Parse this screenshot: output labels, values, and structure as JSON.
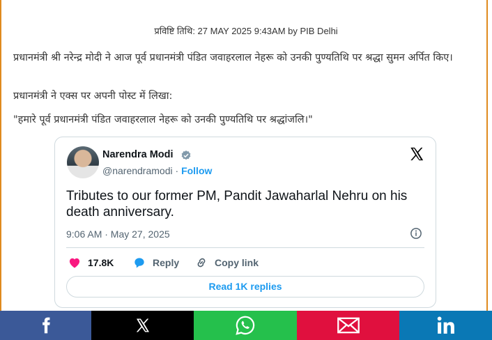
{
  "release": {
    "meta": "प्रविष्टि तिथि: 27 MAY 2025 9:43AM by PIB Delhi"
  },
  "body": {
    "para1": "प्रधानमंत्री श्री नरेन्द्र मोदी ने आज पूर्व प्रधानमंत्री पंडित जवाहरलाल नेहरू को उनकी पुण्यतिथि पर श्रद्धा सुमन अर्पित किए।",
    "para2": "प्रधानमंत्री ने एक्स पर अपनी पोस्ट में लिखा:",
    "para3": "\"हमारे पूर्व प्रधानमंत्री पंडित जवाहरलाल नेहरू को उनकी पुण्यतिथि पर श्रद्धांजलि।\""
  },
  "tweet": {
    "author_name": "Narendra Modi",
    "handle": "@narendramodi",
    "separator": "·",
    "follow_label": "Follow",
    "text": "Tributes to our former PM, Pandit Jawaharlal Nehru on his death anniversary.",
    "timestamp": "9:06 AM · May 27, 2025",
    "likes": "17.8K",
    "reply_label": "Reply",
    "copy_link_label": "Copy link",
    "read_replies_label": "Read 1K replies",
    "accent_color": "#1d9bf0",
    "like_color": "#f91880"
  },
  "share_bar": {
    "items": [
      {
        "icon": "facebook-icon",
        "color": "#3b5998"
      },
      {
        "icon": "x-icon",
        "color": "#000000"
      },
      {
        "icon": "whatsapp-icon",
        "color": "#25c04c"
      },
      {
        "icon": "mail-icon",
        "color": "#e0103e"
      },
      {
        "icon": "linkedin-icon",
        "color": "#0a78b5"
      }
    ]
  }
}
